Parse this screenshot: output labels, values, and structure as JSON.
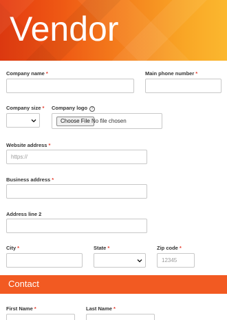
{
  "header": {
    "title": "Vendor"
  },
  "form": {
    "company_name": {
      "label": "Company name",
      "req": "*",
      "value": ""
    },
    "main_phone": {
      "label": "Main phone number",
      "req": "*",
      "value": ""
    },
    "company_size": {
      "label": "Company size",
      "req": "*",
      "selected": ""
    },
    "company_logo": {
      "label": "Company logo",
      "help_icon": "question-circle-icon",
      "button_label": "Choose File",
      "status": "No file chosen"
    },
    "website": {
      "label": "Website address",
      "req": "*",
      "placeholder": "https://"
    },
    "business_address": {
      "label": "Business address",
      "req": "*",
      "value": ""
    },
    "address_line2": {
      "label": "Address line 2",
      "value": ""
    },
    "city": {
      "label": "City",
      "req": "*",
      "value": ""
    },
    "state": {
      "label": "State",
      "req": "*",
      "selected": ""
    },
    "zip": {
      "label": "Zip code",
      "req": "*",
      "placeholder": "12345"
    }
  },
  "contact_section": {
    "title": "Contact",
    "first_name": {
      "label": "First Name",
      "req": "*",
      "value": ""
    },
    "last_name": {
      "label": "Last Name",
      "req": "*",
      "value": ""
    }
  },
  "colors": {
    "accent": "#f25a22",
    "required": "#e6392a",
    "hero_start": "#e53a10",
    "hero_end": "#fbb82f"
  }
}
